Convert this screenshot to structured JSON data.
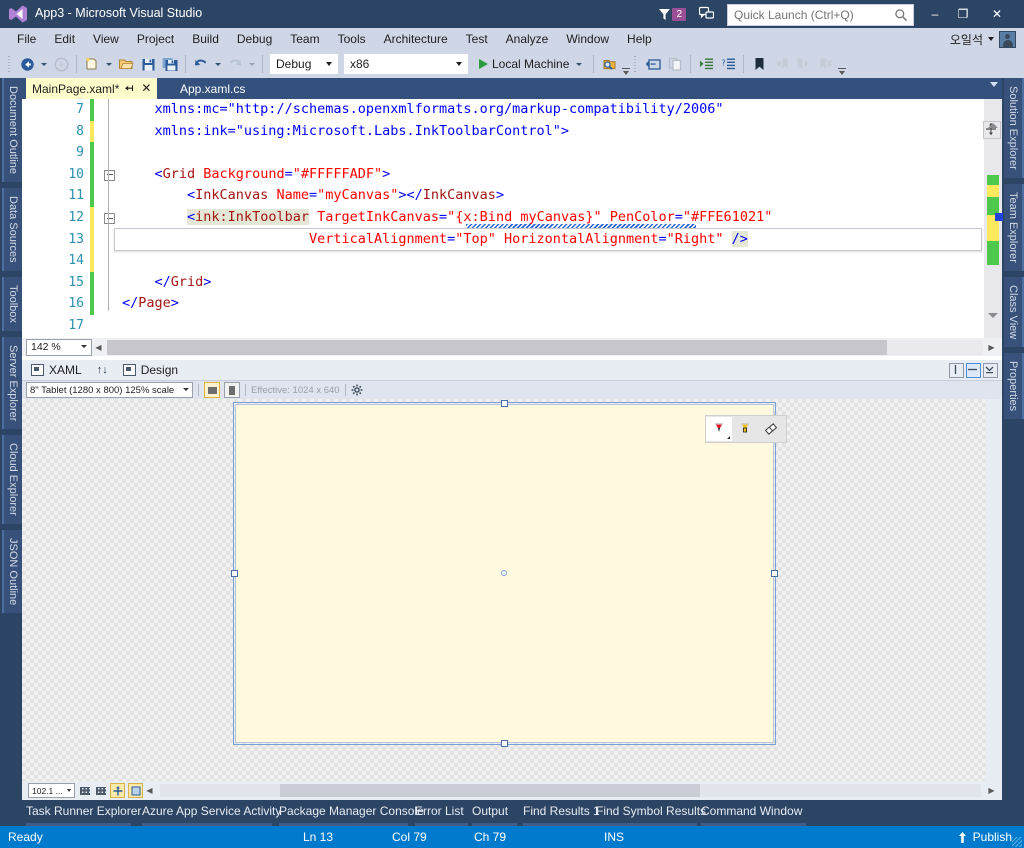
{
  "window": {
    "title": "App3 - Microsoft Visual Studio",
    "logo_icon": "visual-studio-logo-icon",
    "feedback_badge": "2",
    "feedback_icon": "feedback-smiley-icon",
    "notifications_icon": "notification-funnel-icon",
    "minimize": "–",
    "maximize": "❐",
    "close": "✕"
  },
  "quick_launch": {
    "placeholder": "Quick Launch (Ctrl+Q)",
    "value": "",
    "icon": "search-magnifier-icon"
  },
  "menu": {
    "items": [
      {
        "label": "File"
      },
      {
        "label": "Edit"
      },
      {
        "label": "View"
      },
      {
        "label": "Project"
      },
      {
        "label": "Build"
      },
      {
        "label": "Debug"
      },
      {
        "label": "Team"
      },
      {
        "label": "Tools"
      },
      {
        "label": "Architecture"
      },
      {
        "label": "Test"
      },
      {
        "label": "Analyze"
      },
      {
        "label": "Window"
      },
      {
        "label": "Help"
      }
    ],
    "user_name": "오일석"
  },
  "toolbar": {
    "navigate_back_icon": "navigate-back-icon",
    "navigate_forward_icon": "navigate-forward-icon",
    "new_project_icon": "new-project-icon",
    "open_file_icon": "open-file-icon",
    "save_icon": "save-icon",
    "save_all_icon": "save-all-icon",
    "undo_icon": "undo-icon",
    "redo_icon": "redo-icon",
    "configuration": "Debug",
    "platform": "x86",
    "run_target": "Local Machine",
    "find_icon": "find-in-files-icon",
    "toggle_pane_icon": "toggle-pane-icon",
    "copy_icon": "copy-icon",
    "indent_icon": "increase-indent-icon",
    "comment_icon": "comment-selection-icon",
    "bookmark_icon": "bookmark-icon",
    "prev_bookmark_icon": "previous-bookmark-icon",
    "next_bookmark_icon": "next-bookmark-icon",
    "clear_bookmark_icon": "clear-bookmarks-icon"
  },
  "left_dock": {
    "items": [
      {
        "label": "Document Outline"
      },
      {
        "label": "Data Sources"
      },
      {
        "label": "Toolbox"
      },
      {
        "label": "Server Explorer"
      },
      {
        "label": "Cloud Explorer"
      },
      {
        "label": "JSON Outline"
      }
    ]
  },
  "right_dock": {
    "items": [
      {
        "label": "Solution Explorer"
      },
      {
        "label": "Team Explorer"
      },
      {
        "label": "Class View"
      },
      {
        "label": "Properties"
      }
    ]
  },
  "editor": {
    "tabs": [
      {
        "label": "MainPage.xaml*",
        "active": true,
        "pin_icon": "pin-icon",
        "close_icon": "close-icon"
      },
      {
        "label": "App.xaml.cs",
        "active": false
      }
    ],
    "zoom": "142 %",
    "lines": [
      {
        "num": "7",
        "change": "green",
        "text": "    xmlns:mc=\"http://schemas.openxmlformats.org/markup-compatibility/2006\""
      },
      {
        "num": "8",
        "change": "yellow",
        "text": "    xmlns:ink=\"using:Microsoft.Labs.InkToolbarControl\">"
      },
      {
        "num": "9",
        "change": "green",
        "text": ""
      },
      {
        "num": "10",
        "change": "green",
        "text": "    <Grid Background=\"#FFFFFADF\">"
      },
      {
        "num": "11",
        "change": "green",
        "text": "        <InkCanvas Name=\"myCanvas\"></InkCanvas>"
      },
      {
        "num": "12",
        "change": "yellow",
        "text": "        <ink:InkToolbar TargetInkCanvas=\"{x:Bind myCanvas}\" PenColor=\"#FFE61021\""
      },
      {
        "num": "13",
        "change": "yellow",
        "text": "                       VerticalAlignment=\"Top\" HorizontalAlignment=\"Right\" />"
      },
      {
        "num": "14",
        "change": "yellow",
        "text": ""
      },
      {
        "num": "15",
        "change": "green",
        "text": "    </Grid>"
      },
      {
        "num": "16",
        "change": "green",
        "text": "</Page>"
      },
      {
        "num": "17",
        "change": "none",
        "text": ""
      }
    ]
  },
  "designer": {
    "tabs": [
      {
        "label": "XAML",
        "icon": "xaml-view-icon"
      },
      {
        "label": "Design",
        "icon": "design-view-icon"
      }
    ],
    "swap_icon": "swap-panes-icon",
    "vertical_split_icon": "vertical-split-icon",
    "horizontal_split_icon": "horizontal-split-icon",
    "collapse_pane_icon": "collapse-pane-icon",
    "device": "8\" Tablet (1280 x 800) 125% scale",
    "orientation_landscape_icon": "orientation-landscape-icon",
    "orientation_portrait_icon": "orientation-portrait-icon",
    "effective_resolution": "Effective: 1024 x 640",
    "settings_icon": "gear-icon",
    "zoom": "102.1 ...",
    "grid_icon": "show-grid-icon",
    "grid_fine_icon": "grid-fine-icon",
    "snap_icon": "snap-to-gridlines-icon",
    "snap_objects_icon": "snap-to-objects-icon",
    "ink_toolbar": {
      "buttons": [
        {
          "name": "ballpoint-pen-icon",
          "label": "Ballpoint Pen",
          "selected": true,
          "color": "#e61021"
        },
        {
          "name": "highlighter-icon",
          "label": "Highlighter",
          "selected": false,
          "color": "#f2c31d"
        },
        {
          "name": "eraser-icon",
          "label": "Eraser",
          "selected": false,
          "color": "#ffffff"
        }
      ]
    },
    "canvas_background": "#FFFADF"
  },
  "bottom_tabs": {
    "items": [
      {
        "label": "Task Runner Explorer"
      },
      {
        "label": "Azure App Service Activity"
      },
      {
        "label": "Package Manager Console"
      },
      {
        "label": "Error List"
      },
      {
        "label": "Output"
      },
      {
        "label": "Find Results 1"
      },
      {
        "label": "Find Symbol Results"
      },
      {
        "label": "Command Window"
      }
    ]
  },
  "status_bar": {
    "state": "Ready",
    "line": "Ln 13",
    "column": "Col 79",
    "character": "Ch 79",
    "insert_mode": "INS",
    "publish": "Publish",
    "publish_icon": "publish-up-arrow-icon",
    "accent_color": "#007acc"
  }
}
